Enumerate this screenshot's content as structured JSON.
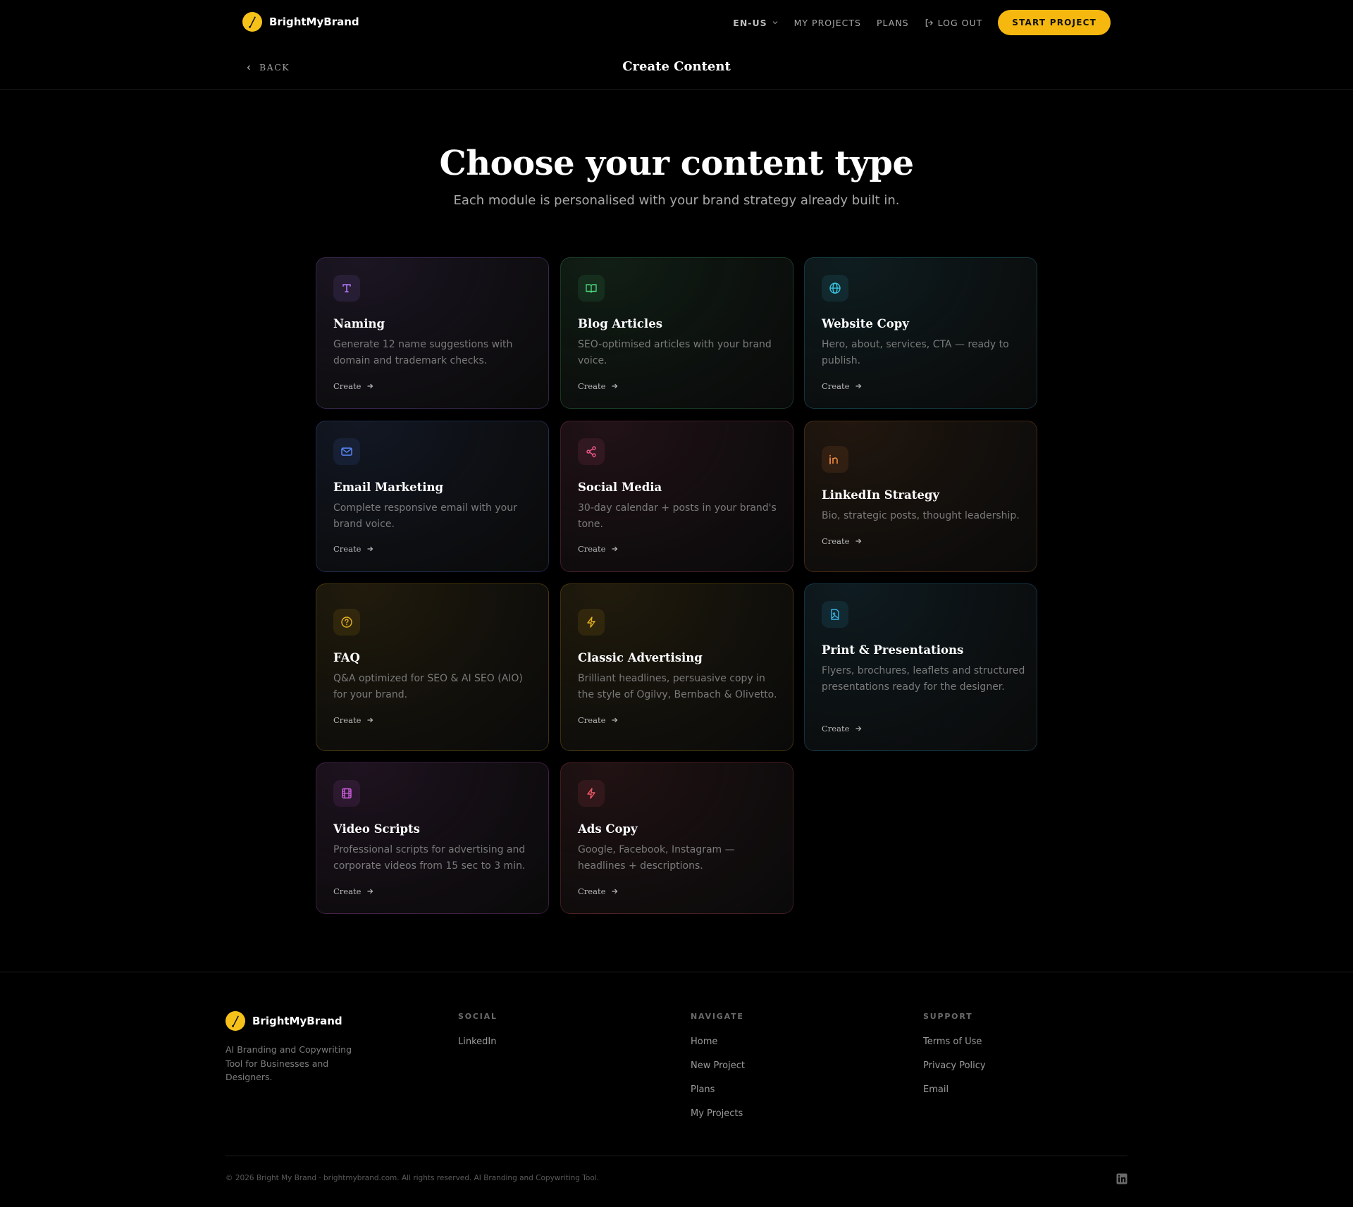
{
  "header": {
    "brand": "BrightMyBrand",
    "lang": "EN-US",
    "nav": [
      "MY PROJECTS",
      "PLANS",
      "LOG OUT"
    ],
    "cta": "START PROJECT"
  },
  "subheader": {
    "back": "BACK",
    "title": "Create Content"
  },
  "hero": {
    "title": "Choose your content type",
    "subtitle": "Each module is personalised with your brand strategy already built in."
  },
  "cards": [
    {
      "title": "Naming",
      "desc": "Generate 12 name suggestions with domain and trademark checks.",
      "cta": "Create",
      "icon": "type-icon",
      "accent": "#B57BFF"
    },
    {
      "title": "Blog Articles",
      "desc": "SEO-optimised articles with your brand voice.",
      "cta": "Create",
      "icon": "book-open-icon",
      "accent": "#4CD37A"
    },
    {
      "title": "Website Copy",
      "desc": "Hero, about, services, CTA — ready to publish.",
      "cta": "Create",
      "icon": "globe-icon",
      "accent": "#38C5E0"
    },
    {
      "title": "Email Marketing",
      "desc": "Complete responsive email with your brand voice.",
      "cta": "Create",
      "icon": "mail-icon",
      "accent": "#5B8CFF"
    },
    {
      "title": "Social Media",
      "desc": "30-day calendar + posts in your brand's tone.",
      "cta": "Create",
      "icon": "share-icon",
      "accent": "#F05A8A"
    },
    {
      "title": "LinkedIn Strategy",
      "desc": "Bio, strategic posts, thought leadership.",
      "cta": "Create",
      "icon": "linkedin-icon",
      "accent": "#F08A3C"
    },
    {
      "title": "FAQ",
      "desc": "Q&A optimized for SEO & AI SEO (AIO) for your brand.",
      "cta": "Create",
      "icon": "help-circle-icon",
      "accent": "#E8B320"
    },
    {
      "title": "Classic Advertising",
      "desc": "Brilliant headlines, persuasive copy in the style of Ogilvy, Bernbach & Olivetto.",
      "cta": "Create",
      "icon": "zap-icon",
      "accent": "#E8B320"
    },
    {
      "title": "Print & Presentations",
      "desc": "Flyers, brochures, leaflets and structured presentations ready for the designer.",
      "cta": "Create",
      "icon": "file-image-icon",
      "accent": "#38B8E8"
    },
    {
      "title": "Video Scripts",
      "desc": "Professional scripts for advertising and corporate videos from 15 sec to 3 min.",
      "cta": "Create",
      "icon": "film-icon",
      "accent": "#D060E0"
    },
    {
      "title": "Ads Copy",
      "desc": "Google, Facebook, Instagram — headlines + descriptions.",
      "cta": "Create",
      "icon": "zap-icon",
      "accent": "#F05A6A"
    }
  ],
  "footer": {
    "brand": "BrightMyBrand",
    "desc": "AI Branding and Copywriting Tool for Businesses and Designers.",
    "social": {
      "title": "SOCIAL",
      "links": [
        "LinkedIn"
      ]
    },
    "navigate": {
      "title": "NAVIGATE",
      "links": [
        "Home",
        "New Project",
        "Plans",
        "My Projects"
      ]
    },
    "support": {
      "title": "SUPPORT",
      "links": [
        "Terms of Use",
        "Privacy Policy",
        "Email"
      ]
    },
    "copyright": "© 2026 Bright My Brand · brightmybrand.com. All rights reserved. AI Branding and Copywriting Tool."
  }
}
